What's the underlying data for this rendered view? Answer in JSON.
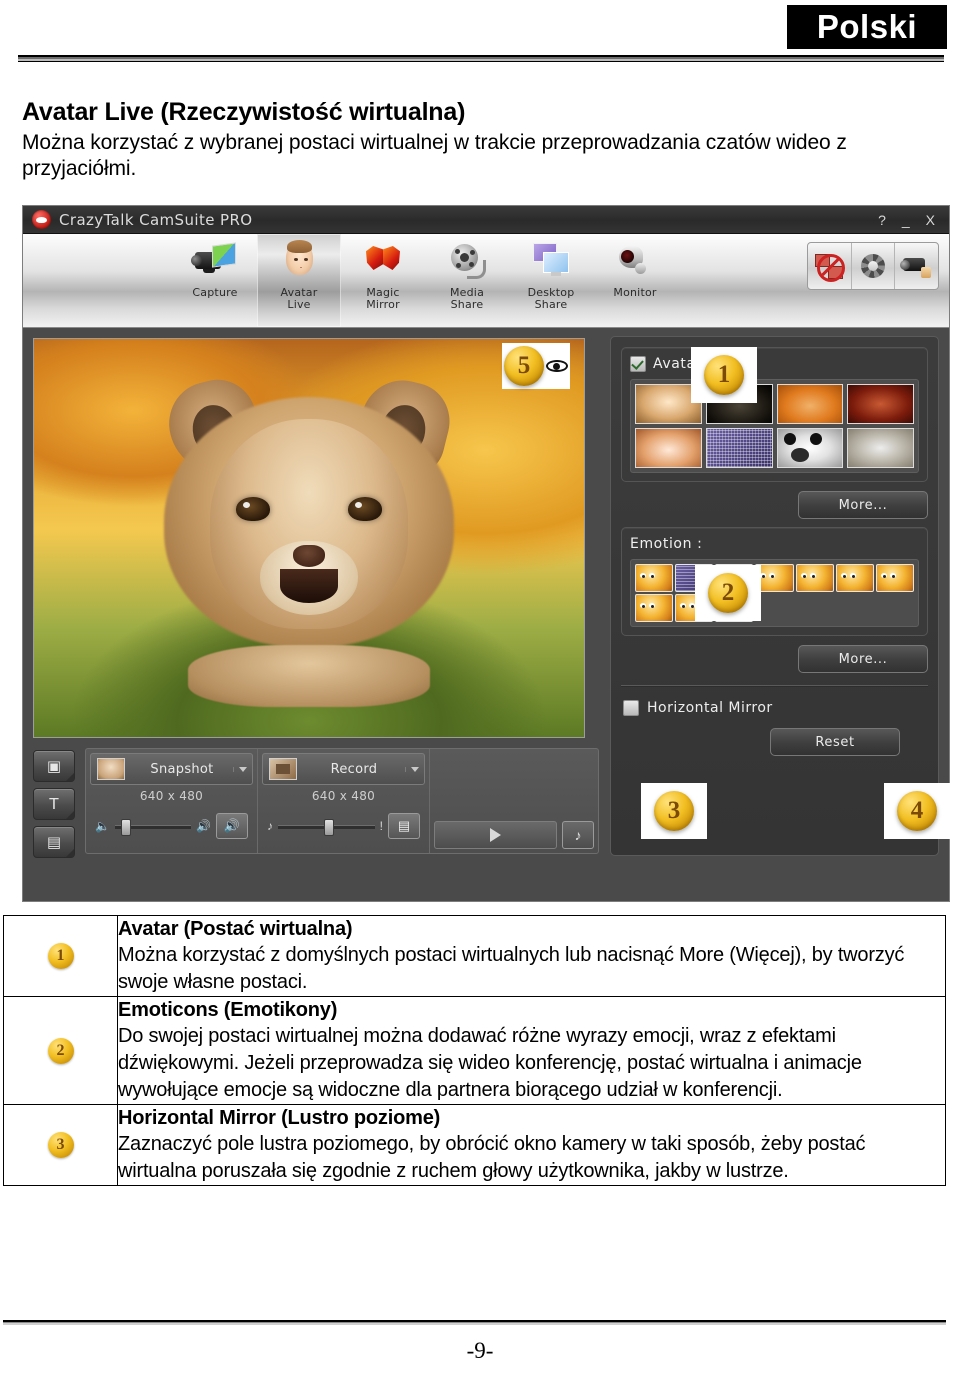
{
  "page": {
    "language_badge": "Polski",
    "page_number": "-9-"
  },
  "intro": {
    "heading": "Avatar Live (Rzeczywistość wirtualna)",
    "body": "Można korzystać z wybranej postaci wirtualnej w trakcie przeprowadzania czatów wideo z przyjaciółmi."
  },
  "app": {
    "title": "CrazyTalk CamSuite PRO",
    "window_controls": {
      "help": "?",
      "minimize": "_",
      "close": "X"
    },
    "toolbar": {
      "items": [
        {
          "label": "Capture",
          "icon": "capture-icon",
          "active": false
        },
        {
          "label": "Avatar\nLive",
          "label_line1": "Avatar",
          "label_line2": "Live",
          "icon": "avatar-face-icon",
          "active": true
        },
        {
          "label_line1": "Magic",
          "label_line2": "Mirror",
          "icon": "magic-mirror-mask-icon",
          "active": false
        },
        {
          "label_line1": "Media",
          "label_line2": "Share",
          "icon": "media-share-film-icon",
          "active": false
        },
        {
          "label_line1": "Desktop",
          "label_line2": "Share",
          "icon": "desktop-share-icon",
          "active": false
        },
        {
          "label_line1": "Monitor",
          "label_line2": "",
          "icon": "monitor-webcam-icon",
          "active": false
        }
      ],
      "right_buttons": [
        {
          "name": "disable-chat-icon"
        },
        {
          "name": "settings-gear-icon"
        },
        {
          "name": "select-camera-icon"
        }
      ]
    },
    "preview": {
      "overlay_marker": "5",
      "eye_icon": "eye-preview-icon"
    },
    "bottom_controls": {
      "side_buttons": [
        {
          "name": "camera-effect-button",
          "glyph": "▣"
        },
        {
          "name": "text-tool-button",
          "glyph": "T"
        },
        {
          "name": "frame-tool-button",
          "glyph": "▤"
        }
      ],
      "snapshot": {
        "label": "Snapshot",
        "resolution": "640 x 480"
      },
      "record": {
        "label": "Record",
        "resolution": "640 x 480"
      }
    },
    "right_panel": {
      "avatar": {
        "label": "Avatar :",
        "checked": true,
        "marker": "1",
        "thumbnails": [
          {
            "name": "avatar-boy"
          },
          {
            "name": "avatar-dark-knight"
          },
          {
            "name": "avatar-orange-king"
          },
          {
            "name": "avatar-red-warrior"
          },
          {
            "name": "avatar-doll-girl"
          },
          {
            "name": "avatar-purple-selected"
          },
          {
            "name": "avatar-panda"
          },
          {
            "name": "avatar-stone-statue"
          }
        ],
        "more_label": "More..."
      },
      "emotion": {
        "label": "Emotion :",
        "marker": "2",
        "emoticons": [
          {
            "name": "emoticon-angry-wink"
          },
          {
            "name": "emoticon-selected"
          },
          {
            "name": "emoticon-sleepy"
          },
          {
            "name": "emoticon-tongue-kiss"
          },
          {
            "name": "emoticon-confused"
          },
          {
            "name": "emoticon-surprised"
          },
          {
            "name": "emoticon-crying"
          },
          {
            "name": "emoticon-smile"
          },
          {
            "name": "emoticon-grin"
          },
          {
            "name": "emoticon-devil"
          }
        ],
        "more_label": "More..."
      },
      "horizontal_mirror": {
        "label": "Horizontal Mirror",
        "checked": false,
        "marker": "3"
      },
      "reset": {
        "label": "Reset",
        "marker": "4"
      }
    }
  },
  "explanations": [
    {
      "marker": "1",
      "title": "Avatar (Postać wirtualna)",
      "body": "Można korzystać z domyślnych postaci wirtualnych lub nacisnąć More (Więcej), by tworzyć swoje własne postaci."
    },
    {
      "marker": "2",
      "title": "Emoticons (Emotikony)",
      "body": "Do swojej postaci wirtualnej można dodawać różne wyrazy emocji, wraz z efektami dźwiękowymi. Jeżeli przeprowadza się wideo konferencję, postać wirtualna i animacje wywołujące emocje są widoczne dla partnera biorącego udział w konferencji."
    },
    {
      "marker": "3",
      "title": "Horizontal Mirror (Lustro poziome)",
      "body": "Zaznaczyć pole lustra poziomego, by obrócić okno kamery w taki sposób, żeby postać wirtualna poruszała się zgodnie z ruchem głowy użytkownika, jakby w lustrze."
    }
  ]
}
